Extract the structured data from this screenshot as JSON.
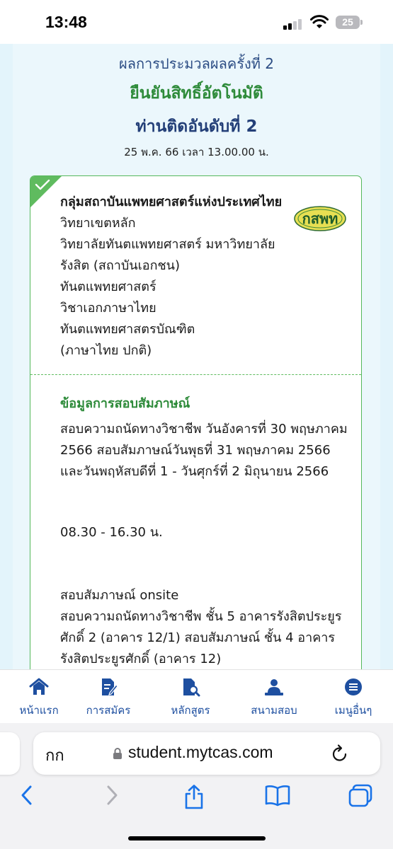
{
  "status_bar": {
    "time": "13:48",
    "battery": "25"
  },
  "header": {
    "round": "ผลการประมวลผลครั้งที่ 2",
    "confirm": "ยืนยันสิทธิ์อัตโนมัติ",
    "rank": "ท่านติดอันดับที่ 2",
    "datetime": "25 พ.ค. 66 เวลา 13.00.00 น."
  },
  "card": {
    "logo_text": "กสพท",
    "lines": [
      "กลุ่มสถาบันแพทยศาสตร์แห่งประเทศไทย",
      "วิทยาเขตหลัก",
      "วิทยาลัยทันตแพทยศาสตร์ มหาวิทยาลัย",
      "รังสิต (สถาบันเอกชน)",
      "ทันตแพทยศาสตร์",
      "วิชาเอกภาษาไทย",
      "ทันตแพทยศาสตรบัณฑิต",
      "(ภาษาไทย ปกติ)"
    ],
    "interview_title": "ข้อมูลการสอบสัมภาษณ์",
    "interview_dates": [
      "สอบความถนัดทางวิชาชีพ วันอังคารที่ 30 พฤษภาคม",
      "2566 สอบสัมภาษณ์วันพุธที่ 31 พฤษภาคม 2566",
      "และวันพฤหัสบดีที่ 1 - วันศุกร์ที่ 2 มิถุนายน 2566"
    ],
    "interview_time": "08.30 - 16.30 น.",
    "interview_place": [
      "สอบสัมภาษณ์ onsite",
      "สอบความถนัดทางวิชาชีพ ชั้น 5 อาคารรังสิตประยูร",
      "ศักดิ์ 2 (อาคาร 12/1) สอบสัมภาษณ์ ชั้น 4 อาคาร",
      "รังสิตประยูรศักดิ์ (อาคาร 12)"
    ]
  },
  "tabbar": {
    "home": "หน้าแรก",
    "apply": "การสมัคร",
    "courses": "หลักสูตร",
    "venue": "สนามสอบ",
    "more": "เมนูอื่นๆ"
  },
  "browser": {
    "aa": "กก",
    "url": "student.mytcas.com"
  },
  "colors": {
    "green": "#2e8b3a",
    "navy": "#233f78",
    "tab_blue": "#1e4fa0",
    "page_bg": "#e3f4fb"
  }
}
